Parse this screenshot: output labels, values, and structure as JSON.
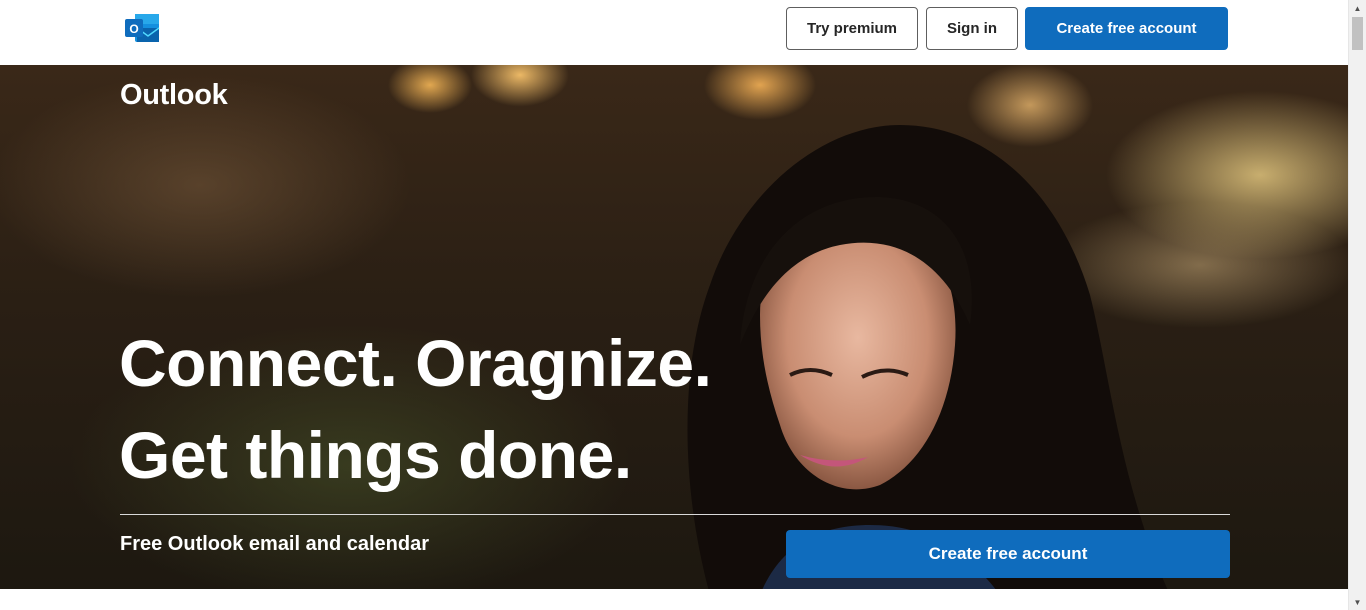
{
  "header": {
    "logo_icon": "outlook-logo-icon",
    "logo_letter": "O",
    "try_premium_label": "Try premium",
    "sign_in_label": "Sign in",
    "create_account_label": "Create free account"
  },
  "hero": {
    "brand": "Outlook",
    "headline_line1": "Connect. Oragnize.",
    "headline_line2": "Get things done.",
    "subtitle": "Free Outlook email and calendar",
    "cta_label": "Create free account",
    "image": "woman-smiling-at-device-night-photo"
  },
  "colors": {
    "accent": "#0f6cbd",
    "header_bg": "#ffffff",
    "hero_text": "#ffffff"
  },
  "scrollbar": {
    "up_icon": "scroll-up-arrow-icon",
    "down_icon": "scroll-down-arrow-icon"
  }
}
